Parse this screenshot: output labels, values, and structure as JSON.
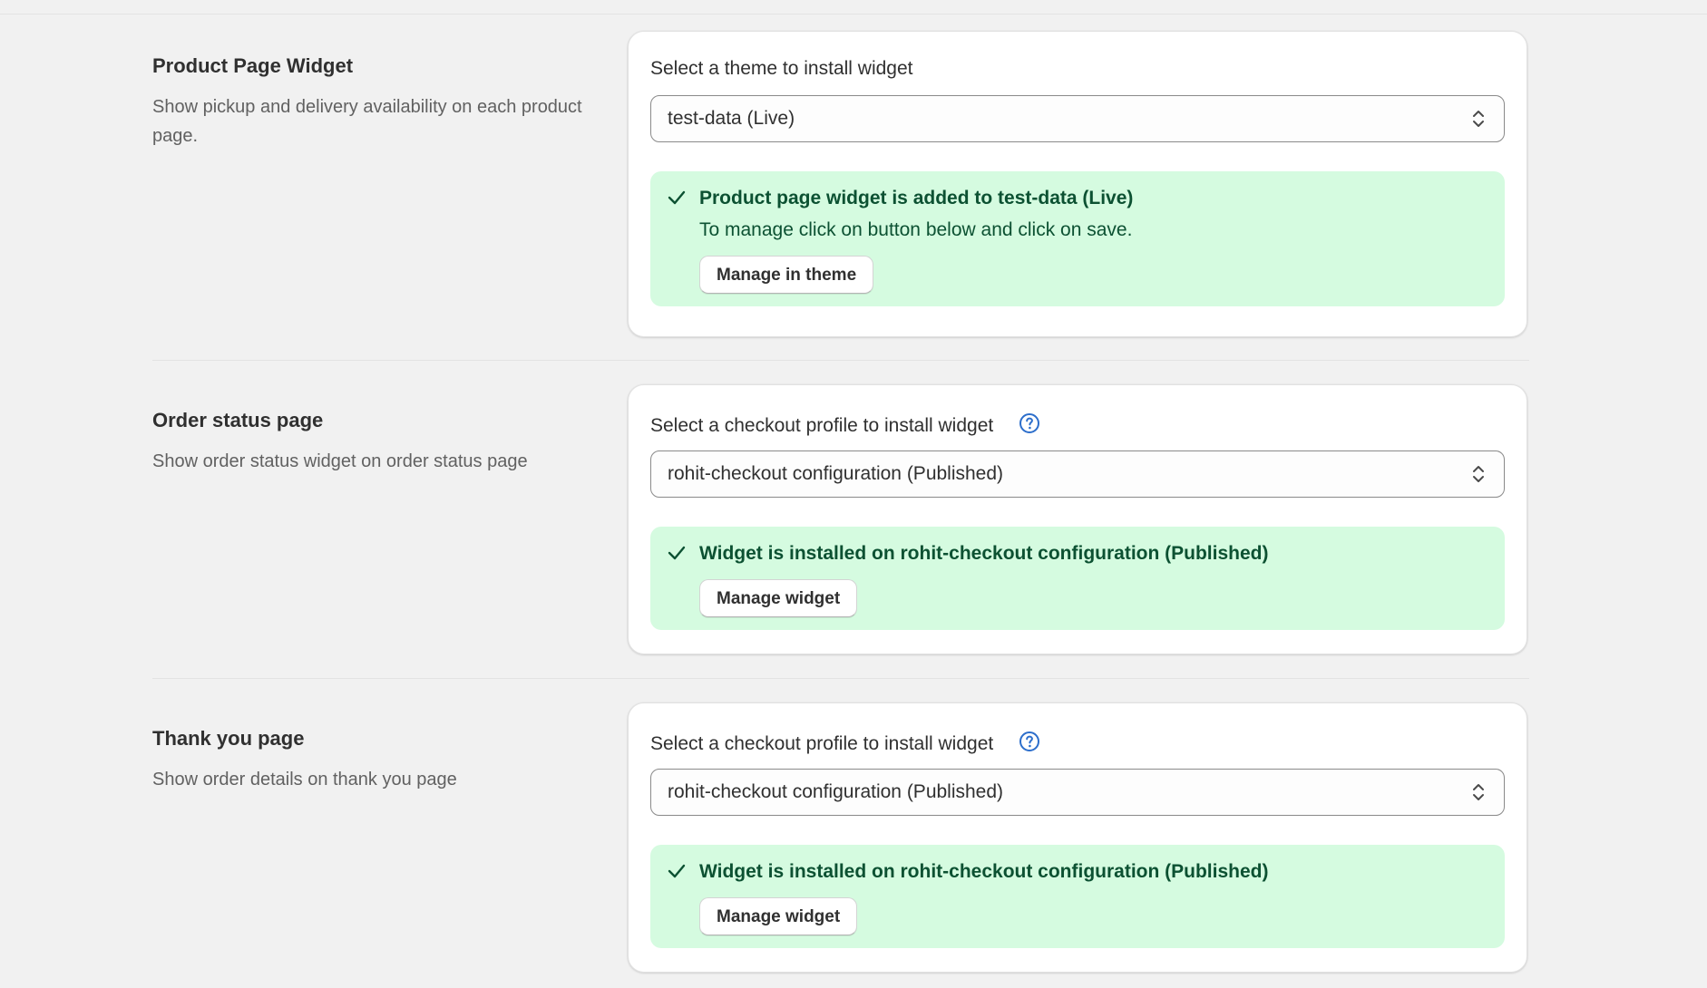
{
  "sections": [
    {
      "title": "Product Page Widget",
      "description": "Show pickup and delivery availability on each product page.",
      "field_label": "Select a theme to install widget",
      "select_value": "test-data (Live)",
      "banner_title": "Product page widget is added to test-data (Live)",
      "banner_text": "To manage click on button below and click on save.",
      "button_label": "Manage in theme"
    },
    {
      "title": "Order status page",
      "description": "Show order status widget on order status page",
      "field_label": "Select a checkout profile to install widget",
      "select_value": "rohit-checkout configuration (Published)",
      "banner_title": "Widget is installed on rohit-checkout configuration (Published)",
      "button_label": "Manage widget"
    },
    {
      "title": "Thank you page",
      "description": "Show order details on thank you page",
      "field_label": "Select a checkout profile to install widget",
      "select_value": "rohit-checkout configuration (Published)",
      "banner_title": "Widget is installed on rohit-checkout configuration (Published)",
      "button_label": "Manage widget"
    }
  ],
  "icons": {
    "help": "question-circle-icon",
    "check": "checkmark-icon",
    "select_arrows": "select-chevrons-icon"
  },
  "colors": {
    "page_bg": "#f1f1f1",
    "card_bg": "#ffffff",
    "success_bg": "#d5fbe0",
    "success_text": "#0c5132",
    "help_icon": "#2c6ecb"
  }
}
